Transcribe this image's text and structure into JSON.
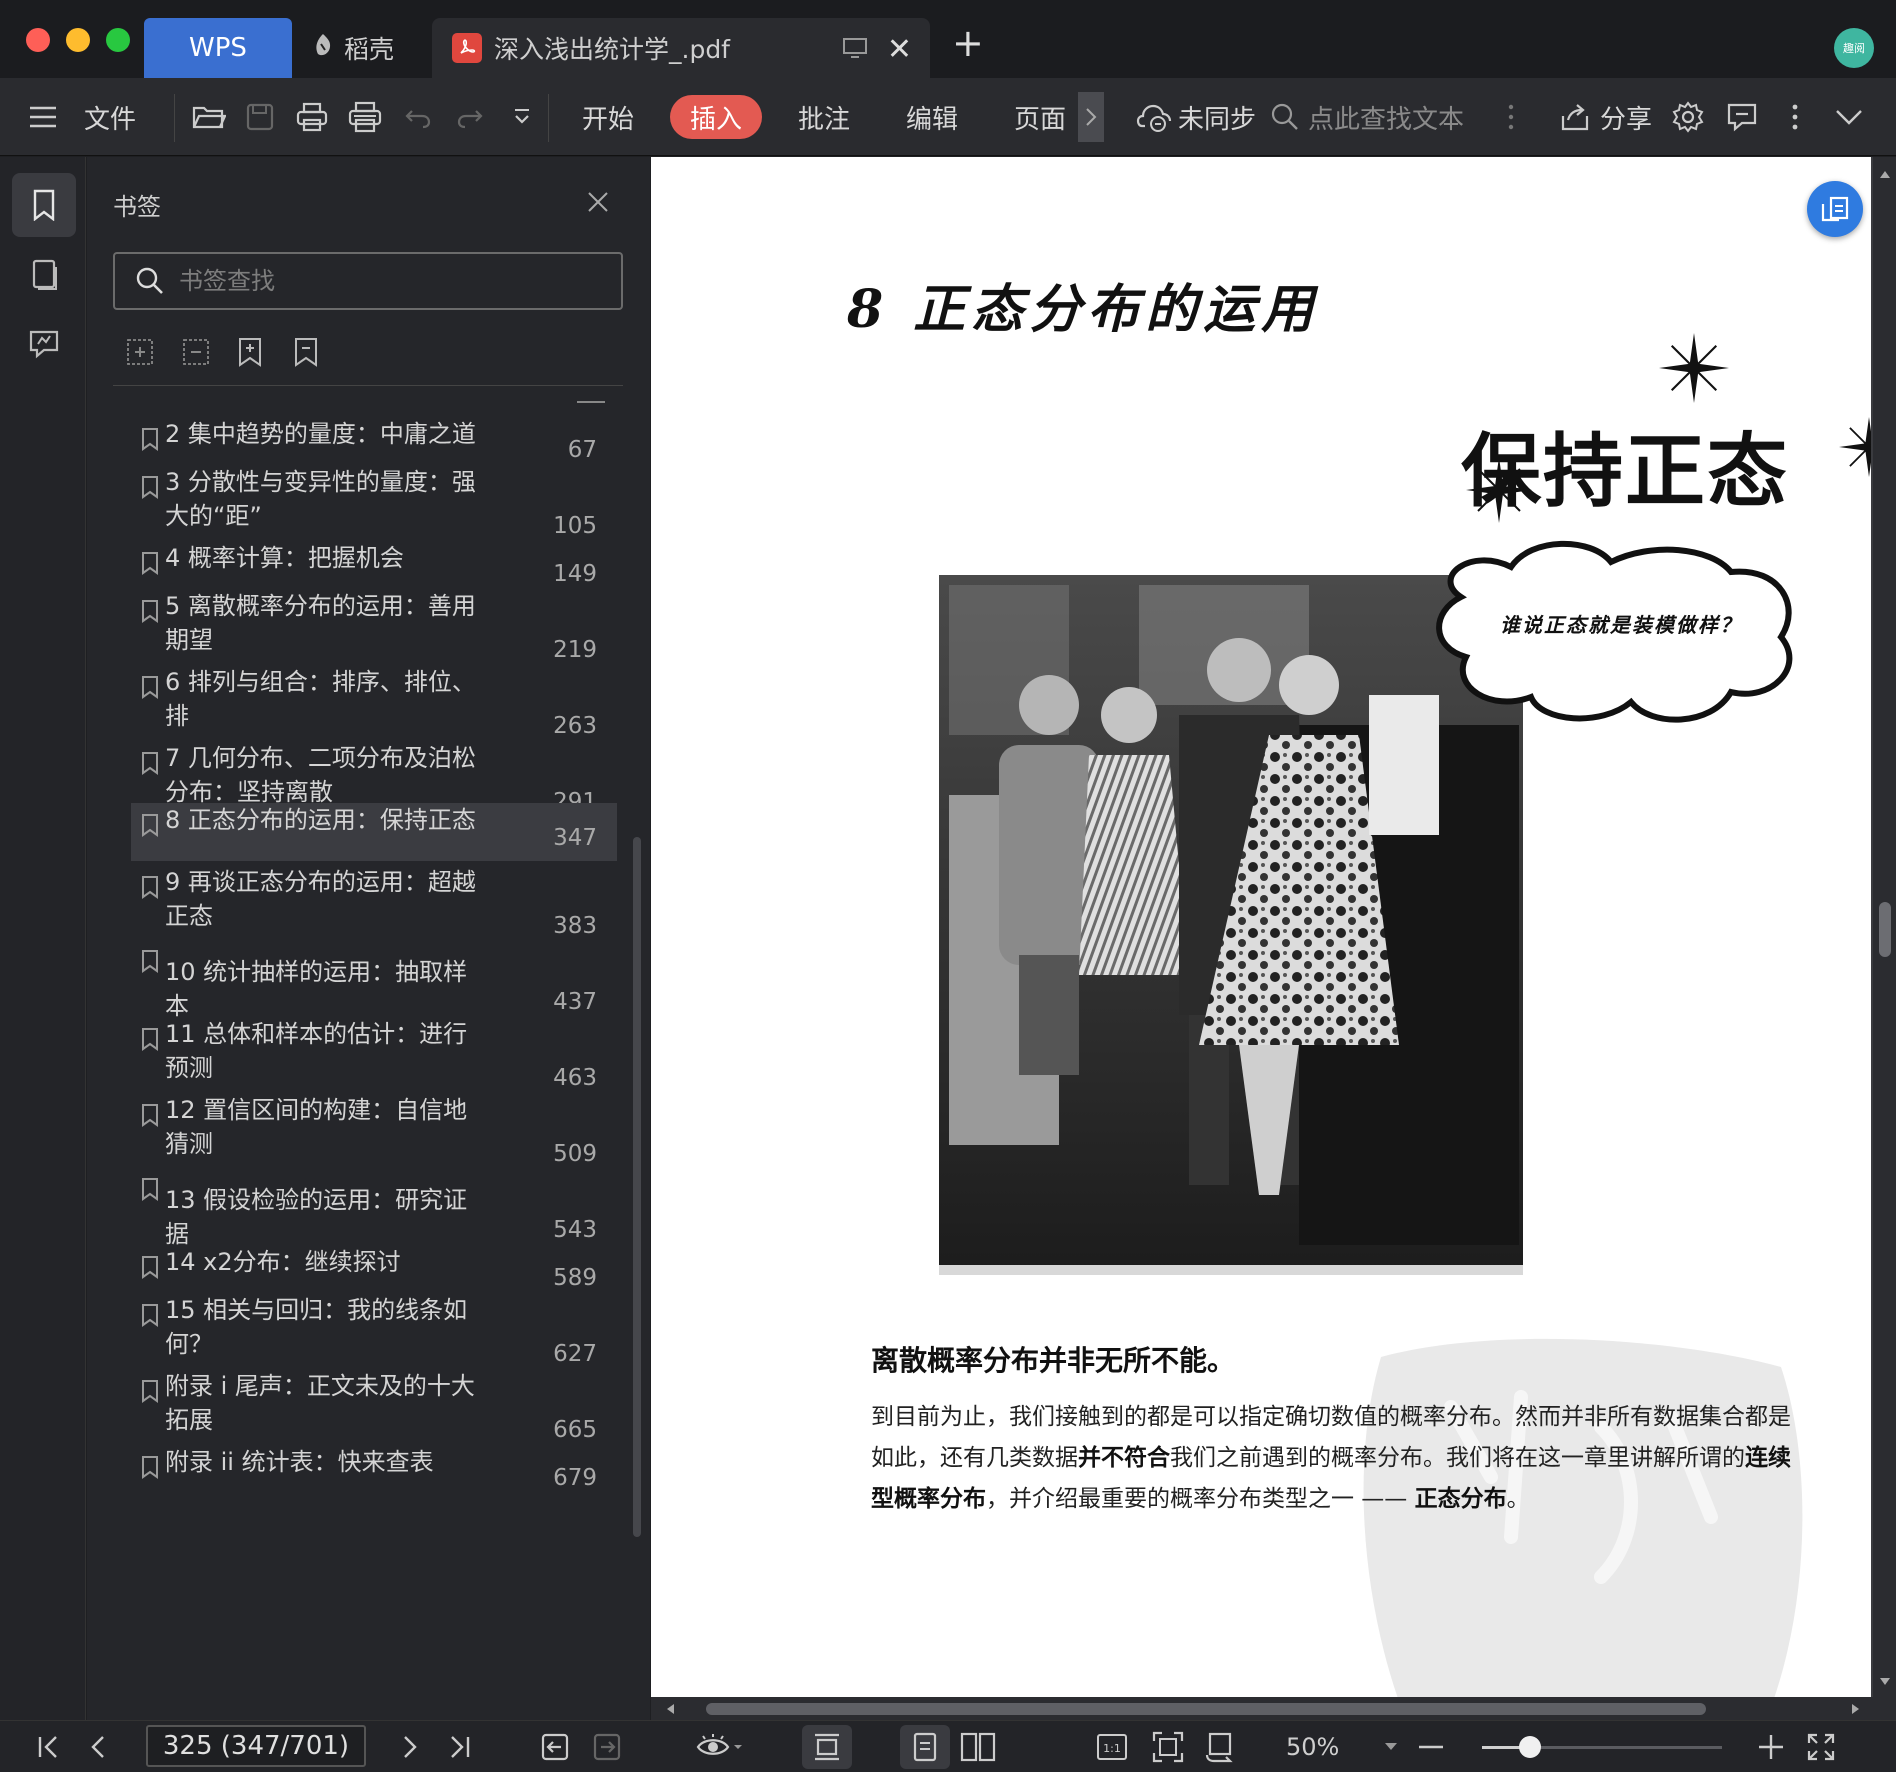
{
  "titlebar": {
    "tabs": [
      {
        "label": "WPS"
      },
      {
        "label": "稻壳"
      },
      {
        "label": "深入浅出统计学_.pdf"
      }
    ],
    "avatar_text": "趣阅"
  },
  "toolbar": {
    "file_label": "文件",
    "menu": [
      "开始",
      "插入",
      "批注",
      "编辑",
      "页面"
    ],
    "sync_label": "未同步",
    "search_placeholder": "点此查找文本",
    "share_label": "分享"
  },
  "sidebar": {
    "title": "书签",
    "search_placeholder": "书签查找",
    "items": [
      {
        "label": "2  集中趋势的量度：中庸之道",
        "page": "67"
      },
      {
        "label": " 3  分散性与变异性的量度：强大的“距”",
        "page": "105"
      },
      {
        "label": "4  概率计算：把握机会",
        "page": "149"
      },
      {
        "label": "5  离散概率分布的运用：善用期望",
        "page": "219"
      },
      {
        "label": "6  排列与组合：排序、排位、排",
        "page": "263"
      },
      {
        "label": "7  几何分布、二项分布及泊松分布：坚持离散",
        "page": "291"
      },
      {
        "label": "8  正态分布的运用：保持正态",
        "page": "347"
      },
      {
        "label": "9  再谈正态分布的运用：超越正态",
        "page": "383"
      },
      {
        "label": "10  统计抽样的运用：抽取样本",
        "page": "437"
      },
      {
        "label": "11  总体和样本的估计：进行预测",
        "page": "463"
      },
      {
        "label": "12  置信区间的构建：自信地猜测",
        "page": "509"
      },
      {
        "label": "13  假设检验的运用：研究证据",
        "page": "543"
      },
      {
        "label": "14  x2分布：继续探讨",
        "page": "589"
      },
      {
        "label": "15  相关与回归：我的线条如何？",
        "page": "627"
      },
      {
        "label": "附录 i    尾声：正文未及的十大拓展",
        "page": "665"
      },
      {
        "label": "附录 ii    统计表：快来查表",
        "page": "679"
      }
    ],
    "active_index": 6
  },
  "document": {
    "chapter_heading": "8 正态分布的运用",
    "big_title": "保持正态",
    "speech_bubble": "谁说正态就是装模做样？",
    "lead": "离散概率分布并非无所不能。",
    "para_1": "到目前为止，我们接触到的都是可以指定确切数值的概率分布。然而并非所有数据集合都是如此，还有几类数据",
    "para_bold_1": "并不符合",
    "para_2": "我们之前遇到的概率分布。我们将在这一章里讲解所谓的",
    "para_bold_2": "连续型概率分布",
    "para_3": "，并介绍最重要的概率分布类型之一 —— ",
    "para_bold_3": "正态分布",
    "para_4": "。"
  },
  "statusbar": {
    "page_indicator": "325 (347/701)",
    "zoom": "50%",
    "zoom_fraction": 0.2
  },
  "colors": {
    "accent_blue": "#3a6fd0",
    "insert_red": "#e35a52",
    "float_button": "#2f7be0"
  },
  "icons": [
    "menu-icon",
    "open-folder-icon",
    "save-icon",
    "print-icon",
    "print-preview-icon",
    "undo-icon",
    "redo-icon",
    "dropdown-icon",
    "cloud-sync-icon",
    "search-icon",
    "more-icon",
    "share-icon",
    "settings-icon",
    "comment-icon",
    "chevron-down-icon",
    "bookmark-icon",
    "thumbnail-icon",
    "annotation-icon",
    "close-icon"
  ]
}
